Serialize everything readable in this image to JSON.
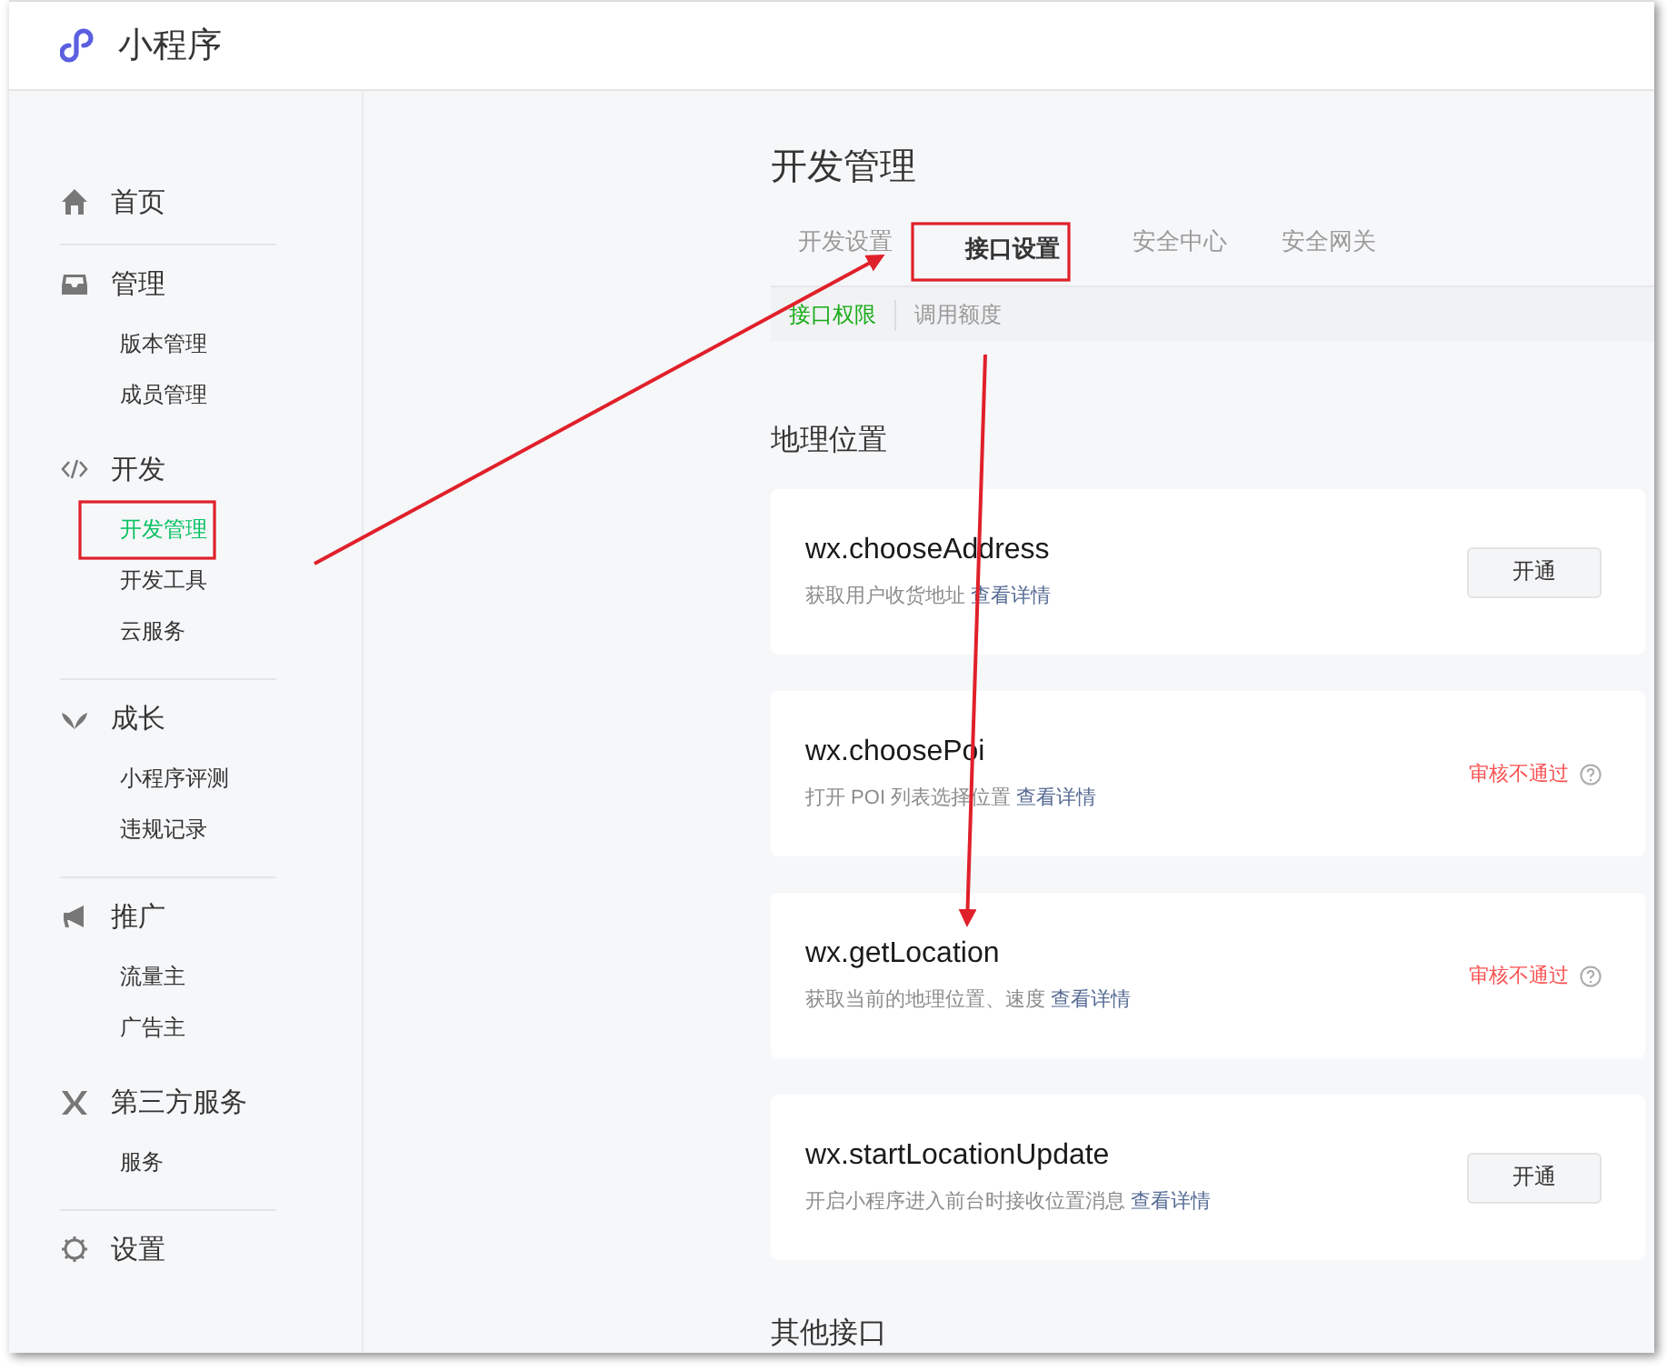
{
  "header": {
    "title": "小程序"
  },
  "sidebar": {
    "groups": [
      {
        "label": "首页"
      },
      {
        "label": "管理",
        "items": [
          {
            "label": "版本管理",
            "selected": false
          },
          {
            "label": "成员管理",
            "selected": false
          }
        ]
      },
      {
        "label": "开发",
        "items": [
          {
            "label": "开发管理",
            "selected": true
          },
          {
            "label": "开发工具",
            "selected": false
          },
          {
            "label": "云服务",
            "selected": false
          }
        ]
      },
      {
        "label": "成长",
        "items": [
          {
            "label": "小程序评测",
            "selected": false
          },
          {
            "label": "违规记录",
            "selected": false
          }
        ]
      },
      {
        "label": "推广",
        "items": [
          {
            "label": "流量主",
            "selected": false
          },
          {
            "label": "广告主",
            "selected": false
          }
        ]
      },
      {
        "label": "第三方服务",
        "items": [
          {
            "label": "服务",
            "selected": false
          }
        ]
      },
      {
        "label": "设置"
      }
    ]
  },
  "page": {
    "title": "开发管理",
    "tabs": [
      {
        "label": "开发设置",
        "selected": false
      },
      {
        "label": "接口设置",
        "selected": true
      },
      {
        "label": "安全中心",
        "selected": false
      },
      {
        "label": "安全网关",
        "selected": false
      }
    ],
    "subtabs": [
      {
        "label": "接口权限",
        "selected": true
      },
      {
        "label": "调用额度",
        "selected": false
      }
    ],
    "sections": [
      {
        "title": "地理位置",
        "apis": [
          {
            "name": "wx.chooseAddress",
            "description": "获取用户收货地址",
            "link": "查看详情",
            "kind": "button",
            "action": "开通"
          },
          {
            "name": "wx.choosePoi",
            "description": "打开 POI 列表选择位置",
            "link": "查看详情",
            "kind": "status",
            "action": "审核不通过"
          },
          {
            "name": "wx.getLocation",
            "description": "获取当前的地理位置、速度",
            "link": "查看详情",
            "kind": "status",
            "action": "审核不通过"
          },
          {
            "name": "wx.startLocationUpdate",
            "description": "开启小程序进入前台时接收位置消息",
            "link": "查看详情",
            "kind": "button",
            "action": "开通"
          }
        ]
      },
      {
        "title": "其他接口"
      }
    ]
  }
}
